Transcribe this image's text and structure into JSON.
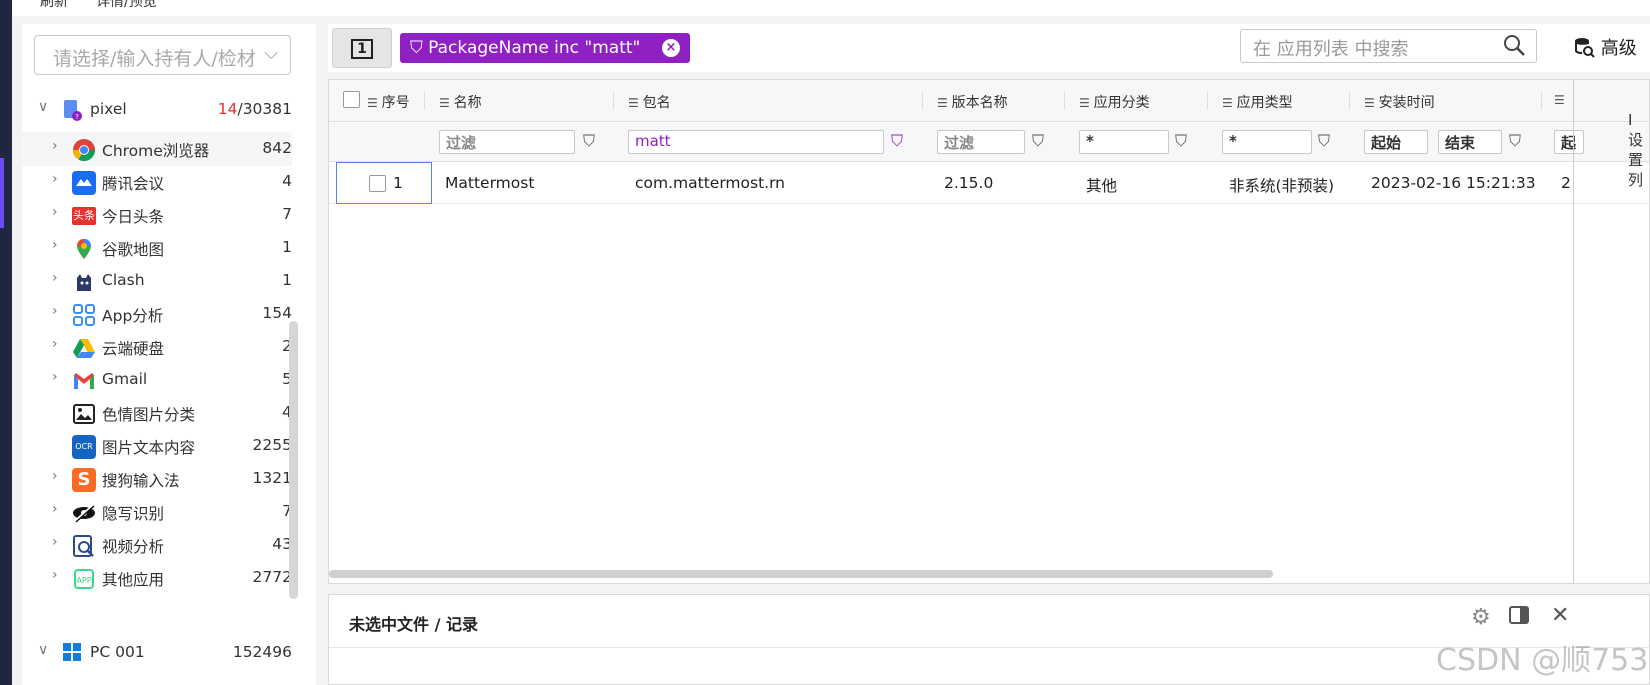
{
  "top": {
    "item1": "刷新",
    "item2": "详情/预览"
  },
  "sidebar": {
    "owner_placeholder": "请选择/输入持有人/检材",
    "device": {
      "name": "pixel",
      "selected": "14",
      "total": "/30381"
    },
    "items": [
      {
        "label": "Chrome浏览器",
        "count": "842",
        "icon": "chrome-icon"
      },
      {
        "label": "腾讯会议",
        "count": "4",
        "icon": "tencent-meeting-icon"
      },
      {
        "label": "今日头条",
        "count": "7",
        "icon": "toutiao-icon"
      },
      {
        "label": "谷歌地图",
        "count": "1",
        "icon": "google-maps-icon"
      },
      {
        "label": "Clash",
        "count": "1",
        "icon": "clash-icon"
      },
      {
        "label": "App分析",
        "count": "154",
        "icon": "app-analysis-icon"
      },
      {
        "label": "云端硬盘",
        "count": "2",
        "icon": "google-drive-icon"
      },
      {
        "label": "Gmail",
        "count": "5",
        "icon": "gmail-icon"
      },
      {
        "label": "色情图片分类",
        "count": "4",
        "icon": "image-icon"
      },
      {
        "label": "图片文本内容",
        "count": "2255",
        "icon": "ocr-icon"
      },
      {
        "label": "搜狗输入法",
        "count": "1321",
        "icon": "sogou-icon"
      },
      {
        "label": "隐写识别",
        "count": "7",
        "icon": "steganography-icon"
      },
      {
        "label": "视频分析",
        "count": "43",
        "icon": "video-analysis-icon"
      },
      {
        "label": "其他应用",
        "count": "2772",
        "icon": "other-apps-icon"
      }
    ],
    "pc": {
      "name": "PC 001",
      "count": "152496"
    }
  },
  "toolbar": {
    "square_button": "1",
    "filter_chip": "PackageName inc \"matt\"",
    "search_placeholder": "在 应用列表 中搜索",
    "advanced": "高级"
  },
  "grid": {
    "columns": [
      "序号",
      "名称",
      "包名",
      "版本名称",
      "应用分类",
      "应用类型",
      "安装时间"
    ],
    "filters": {
      "name": "过滤",
      "package": "matt",
      "version": "过滤",
      "category": "*",
      "type": "*",
      "time_start": "起始",
      "time_end": "结束",
      "time_start2": "起"
    },
    "rows": [
      {
        "index": "1",
        "name": "Mattermost",
        "package": "com.mattermost.rn",
        "version": "2.15.0",
        "category": "其他",
        "type": "非系统(非预装)",
        "install_time": "2023-02-16 15:21:33",
        "extra": "2"
      }
    ],
    "side_fragment": "I\n设\n置\n列"
  },
  "detail": {
    "title": "未选中文件 / 记录"
  },
  "watermark": "CSDN @顺753"
}
